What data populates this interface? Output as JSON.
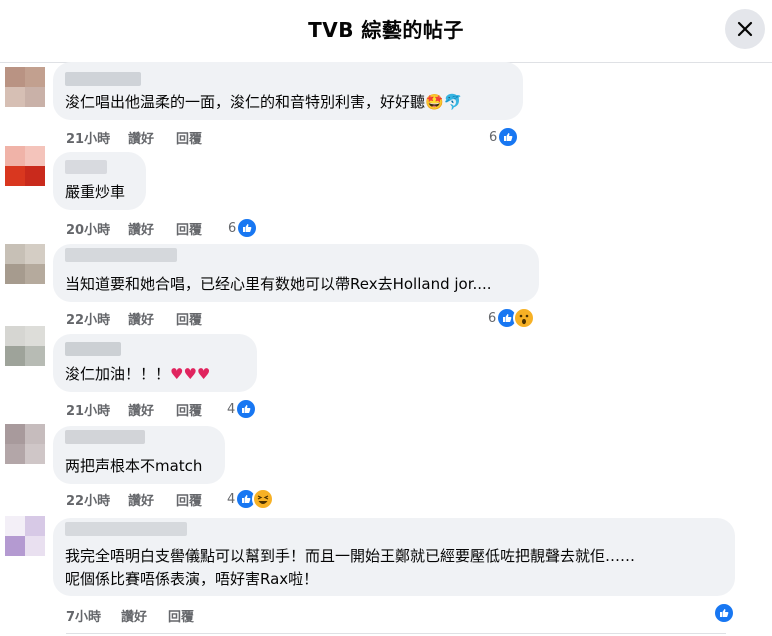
{
  "header": {
    "title": "TVB 綜藝的帖子"
  },
  "labels": {
    "like": "讚好",
    "reply": "回覆"
  },
  "comments": [
    {
      "text": "浚仁唱出他温柔的一面，浚仁的和音特別利害，好好聽🤩🐬",
      "time": "21小時",
      "reactions": "6"
    },
    {
      "text": "嚴重炒車",
      "time": "20小時",
      "reactions": "6"
    },
    {
      "text": "当知道要和她合唱，已经心里有数她可以帶Rex去Holland jor....",
      "time": "22小時",
      "reactions": "6"
    },
    {
      "text": "浚仁加油！！！",
      "time": "21小時",
      "reactions": "4"
    },
    {
      "text": "两把声根本不match",
      "time": "22小時",
      "reactions": "4"
    },
    {
      "text_line1": "我完全唔明白支嚳儀點可以幫到手！而且一開始王鄭就已經要壓低咗把靚聲去就佢……",
      "text_line2": "呢個係比賽唔係表演，唔好害Rax啦！",
      "time": "7小時",
      "reactions": ""
    }
  ]
}
